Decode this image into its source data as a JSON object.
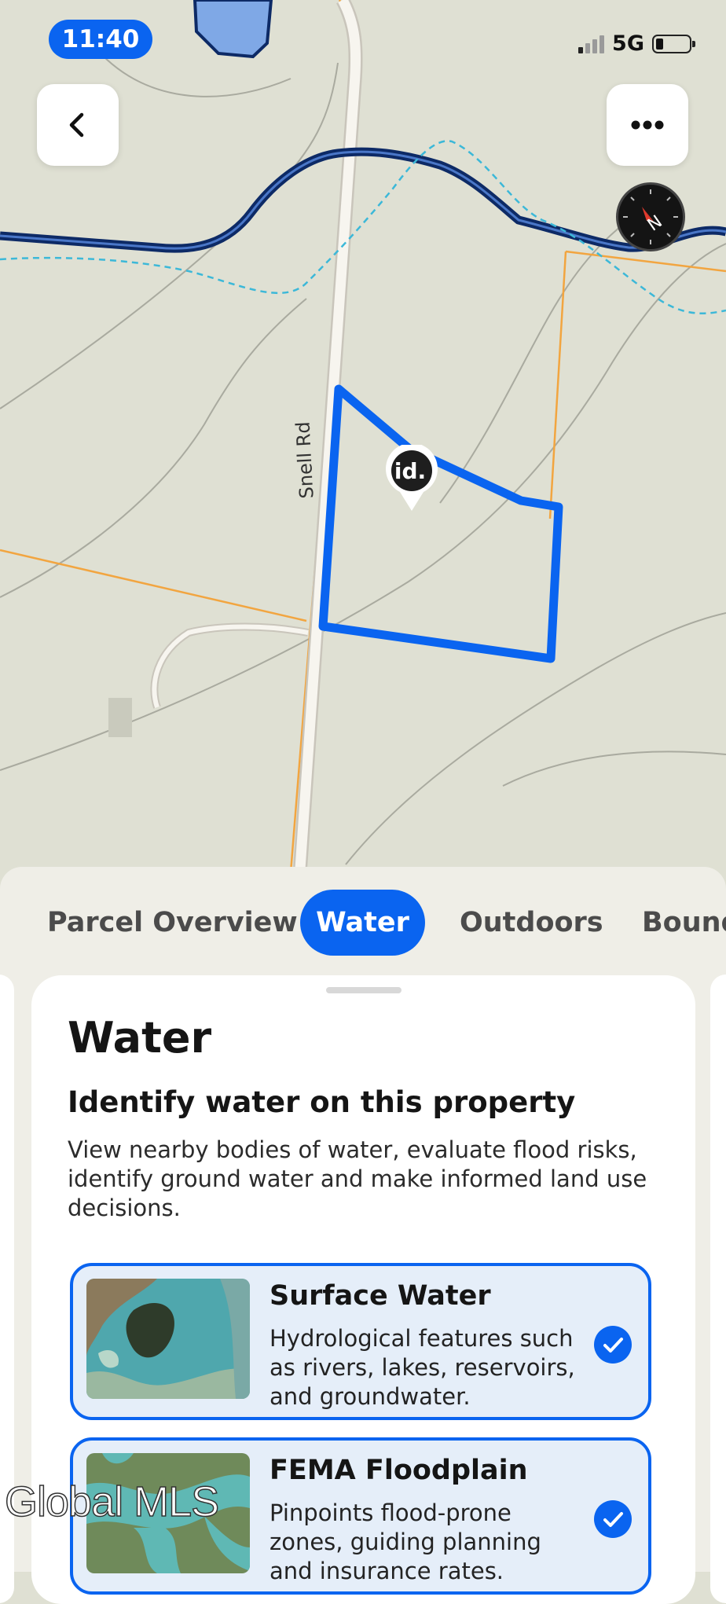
{
  "status_bar": {
    "time": "11:40",
    "network": "5G"
  },
  "map": {
    "road_label": "Snell Rd",
    "marker_text": "id."
  },
  "tabs": [
    "Parcel Overview",
    "Water",
    "Outdoors",
    "Bound"
  ],
  "active_tab": "Water",
  "card": {
    "title": "Water",
    "subtitle": "Identify water on this property",
    "description": "View nearby bodies of water, evaluate flood risks, identify ground water and make informed land use decisions.",
    "options": [
      {
        "title": "Surface Water",
        "description": "Hydrological features such as rivers, lakes, reservoirs, and groundwater.",
        "checked": true
      },
      {
        "title": "FEMA Floodplain",
        "description": "Pinpoints flood-prone zones, guiding planning and insurance rates.",
        "checked": true
      }
    ]
  },
  "watermark": "Global MLS",
  "colors": {
    "accent": "#0a64f0",
    "map_bg": "#dfe0d3",
    "parcel_line": "#f2a540",
    "river": "#0d2a66",
    "stream": "#3cb8d8"
  },
  "icons": {
    "back": "chevron-left-icon",
    "more": "more-horizontal-icon",
    "compass": "compass-icon",
    "check": "check-icon"
  }
}
